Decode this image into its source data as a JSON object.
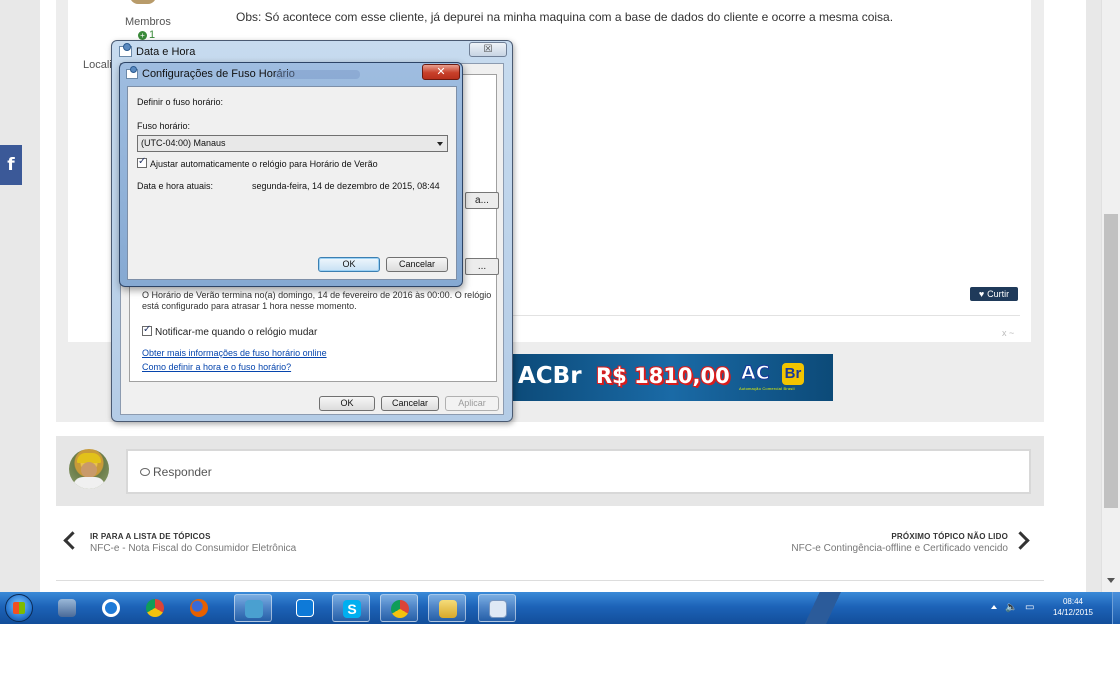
{
  "post": {
    "text": "Obs: Só acontece com esse cliente, já depurei na minha maquina com a base de dados do cliente e ocorre a mesma coisa.",
    "author_role": "Membros",
    "reputation": "1",
    "location_label": "Localiz",
    "like_label": "Curtir",
    "tiny_x": "x ~"
  },
  "social": {
    "facebook_icon": "f"
  },
  "ad": {
    "brand": "ACBr",
    "price": "R$ 1810,00",
    "logo_left": "AC",
    "logo_right": "Br",
    "logo_sub": "Automação Comercial Brasil"
  },
  "reply": {
    "placeholder": "Responder"
  },
  "nav": {
    "prev_title": "IR PARA A LISTA DE TÓPICOS",
    "prev_sub": "NFC-e - Nota Fiscal do Consumidor Eletrônica",
    "next_title": "PRÓXIMO TÓPICO NÃO LIDO",
    "next_sub": "NFC-e Contingência-offline e Certificado vencido"
  },
  "dialog_main": {
    "title": "Data e Hora",
    "close": "☒",
    "btn_partial_1": "a...",
    "btn_partial_2": "...",
    "dst_text": "O Horário de Verão termina no(a) domingo, 14 de fevereiro de 2016 às 00:00. O relógio está configurado para atrasar 1 hora nesse momento.",
    "notify_label": "Notificar-me quando o relógio mudar",
    "link_1": "Obter mais informações de fuso horário online",
    "link_2": "Como definir a hora e o fuso horário?",
    "ok": "OK",
    "cancel": "Cancelar",
    "apply": "Aplicar"
  },
  "dialog_fuso": {
    "title": "Configurações de Fuso Horário",
    "close": "✕",
    "heading": "Definir o fuso horário:",
    "tz_label": "Fuso horário:",
    "tz_value": "(UTC-04:00) Manaus",
    "dst_check": "Ajustar automaticamente o relógio para Horário de Verão",
    "current_label": "Data e hora atuais:",
    "current_value": "segunda-feira, 14 de dezembro de 2015, 08:44",
    "ok": "OK",
    "cancel": "Cancelar"
  },
  "taskbar": {
    "clock_time": "08:44",
    "clock_date": "14/12/2015",
    "colors": {
      "ie": "#1e7ad8",
      "chrome": "#db4437",
      "firefox": "#e66000",
      "skype": "#00aff0",
      "explorer": "#e8c24a"
    }
  }
}
